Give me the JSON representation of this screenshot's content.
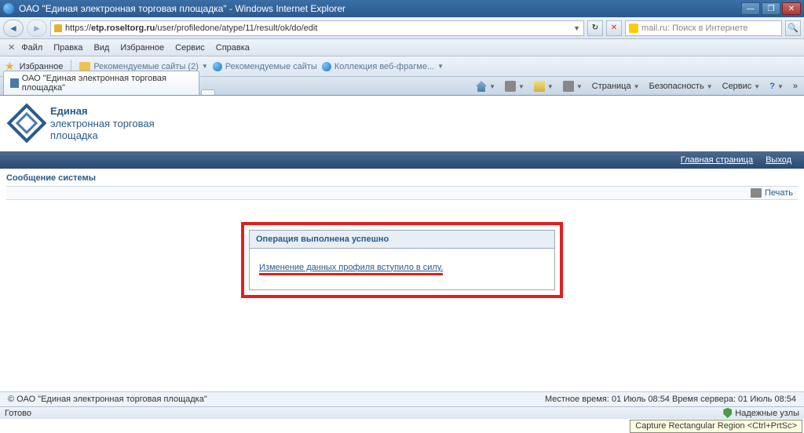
{
  "titlebar": {
    "title": "ОАО \"Единая электронная торговая площадка\" - Windows Internet Explorer"
  },
  "navbar": {
    "url_scheme": "https://",
    "url_host": "etp.roseltorg.ru",
    "url_path": "/user/profiledone/atype/11/result/ok/do/edit",
    "search_placeholder": "mail.ru: Поиск в Интернете"
  },
  "menubar": {
    "items": [
      "Файл",
      "Правка",
      "Вид",
      "Избранное",
      "Сервис",
      "Справка"
    ]
  },
  "favbar": {
    "label": "Избранное",
    "items": [
      "Рекомендуемые сайты (2)",
      "Рекомендуемые сайты",
      "Коллекция веб-фрагме..."
    ]
  },
  "tabs": {
    "active": "ОАО \"Единая электронная торговая площадка\""
  },
  "toolbar": {
    "page": "Страница",
    "safety": "Безопасность",
    "service": "Сервис"
  },
  "logo": {
    "line1": "Единая",
    "line2": "электронная торговая",
    "line3": "площадка"
  },
  "topnav": {
    "home": "Главная страница",
    "exit": "Выход"
  },
  "content": {
    "sys_title": "Сообщение системы",
    "print": "Печать",
    "success_title": "Операция выполнена успешно",
    "success_msg": "Изменение данных профиля вступило в силу."
  },
  "footer": {
    "copyright": "© ОАО \"Единая электронная торговая площадка\"",
    "time": "Местное время: 01 Июль 08:54 Время сервера: 01 Июль 08:54"
  },
  "statusbar": {
    "ready": "Готово",
    "trust": "Надежные узлы"
  },
  "tooltip": {
    "text": "Capture Rectangular Region <Ctrl+PrtSc>"
  }
}
